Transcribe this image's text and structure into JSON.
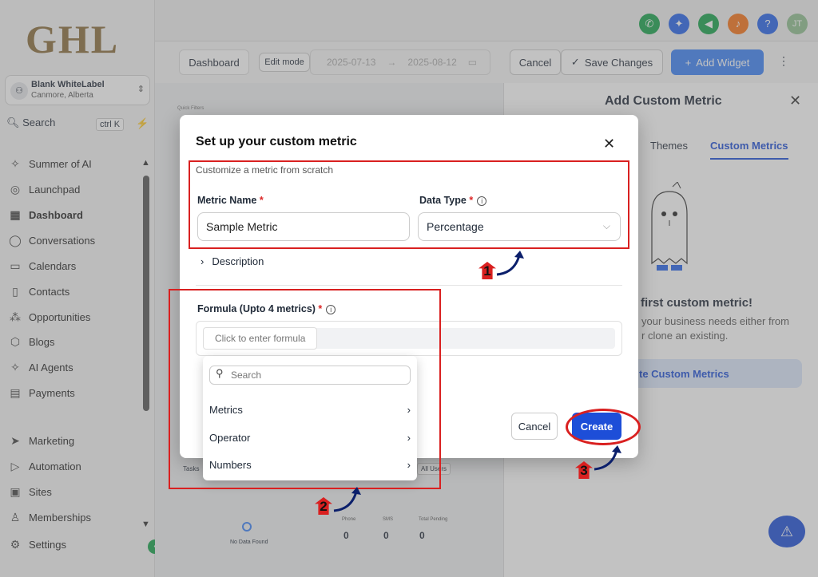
{
  "sidebar": {
    "logo": "GHL",
    "account_name": "Blank WhiteLabel",
    "account_location": "Canmore, Alberta",
    "search_label": "Search",
    "search_shortcut": "ctrl K",
    "items": [
      {
        "label": "Summer of AI",
        "icon": "sparkle-icon"
      },
      {
        "label": "Launchpad",
        "icon": "rocket-icon"
      },
      {
        "label": "Dashboard",
        "icon": "grid-icon"
      },
      {
        "label": "Conversations",
        "icon": "chat-icon"
      },
      {
        "label": "Calendars",
        "icon": "calendar-icon"
      },
      {
        "label": "Contacts",
        "icon": "contacts-icon"
      },
      {
        "label": "Opportunities",
        "icon": "opportunities-icon"
      },
      {
        "label": "Blogs",
        "icon": "box-icon"
      },
      {
        "label": "AI Agents",
        "icon": "sparkle-icon"
      },
      {
        "label": "Payments",
        "icon": "payments-icon"
      },
      {
        "label": "Marketing",
        "icon": "send-icon"
      },
      {
        "label": "Automation",
        "icon": "automation-icon"
      },
      {
        "label": "Sites",
        "icon": "sites-icon"
      },
      {
        "label": "Memberships",
        "icon": "memberships-icon"
      },
      {
        "label": "Settings",
        "icon": "gear-icon"
      }
    ]
  },
  "topbar": {
    "avatar_initials": "JT",
    "icons": [
      {
        "name": "phone-icon",
        "color": "#16a34a"
      },
      {
        "name": "magic-icon",
        "color": "#2563eb"
      },
      {
        "name": "megaphone-icon",
        "color": "#16a34a"
      },
      {
        "name": "bell-icon",
        "color": "#f97316"
      },
      {
        "name": "help-icon",
        "color": "#2563eb"
      }
    ]
  },
  "toolbar": {
    "dashboard_label": "Dashboard",
    "edit_mode": "Edit mode",
    "date_start": "2025-07-13",
    "date_arrow": "→",
    "date_end": "2025-08-12",
    "cancel": "Cancel",
    "save": "Save Changes",
    "add_widget": "Add Widget"
  },
  "right_panel": {
    "title": "Add Custom Metric",
    "tab_themes": "Themes",
    "tab_custom": "Custom Metrics",
    "heading": "first custom metric!",
    "desc_line1": "your business needs either from",
    "desc_line2": "r clone an existing.",
    "button": "te Custom Metrics"
  },
  "modal": {
    "title": "Set up your custom metric",
    "subtitle": "Customize a metric from scratch",
    "metric_name_label": "Metric Name",
    "metric_name_value": "Sample Metric",
    "data_type_label": "Data Type",
    "data_type_value": "Percentage",
    "description_label": "Description",
    "formula_label": "Formula (Upto 4 metrics)",
    "formula_placeholder": "Click to enter formula",
    "cancel": "Cancel",
    "create": "Create",
    "required": "*"
  },
  "dropdown": {
    "search_placeholder": "Search",
    "items": [
      "Metrics",
      "Operator",
      "Numbers"
    ]
  },
  "background": {
    "tasks": "Tasks",
    "all_users": "All Users",
    "no_data": "No Data Found",
    "stat_labels": [
      "Phone",
      "SMS",
      "Total Pending"
    ],
    "stat_values": [
      "0",
      "0",
      "0"
    ],
    "quick_filters": "Quick Filters"
  },
  "annotations": {
    "steps": [
      "1",
      "2",
      "3"
    ],
    "color": "#d92020"
  }
}
